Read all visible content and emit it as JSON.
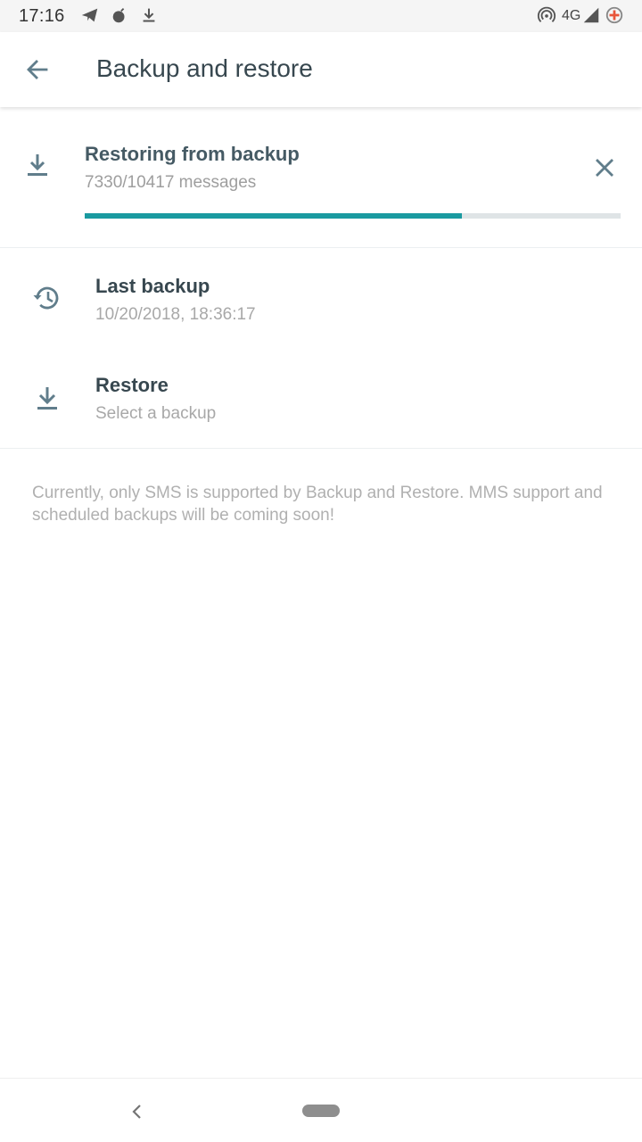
{
  "status_bar": {
    "time": "17:16",
    "network": "4G",
    "icons": [
      "telegram-icon",
      "bomb-icon",
      "download-icon",
      "hotspot-icon",
      "signal-icon",
      "battery-saver-icon"
    ]
  },
  "app_bar": {
    "title": "Backup and restore",
    "back_icon": "arrow-back-icon"
  },
  "restore_progress": {
    "title": "Restoring from backup",
    "subtitle": "7330/10417 messages",
    "progress_fraction": 0.7037,
    "icon": "download-icon",
    "cancel_icon": "close-icon"
  },
  "items": [
    {
      "title": "Last backup",
      "subtitle": "10/20/2018, 18:36:17",
      "icon": "history-icon"
    },
    {
      "title": "Restore",
      "subtitle": "Select a backup",
      "icon": "download-icon"
    }
  ],
  "note": "Currently, only SMS is supported by Backup and Restore. MMS support and scheduled backups will be coming soon!",
  "colors": {
    "accent": "#1a9aa0",
    "icon": "#607d8b",
    "text_primary": "#37474f",
    "text_secondary": "#a8a8a8"
  }
}
